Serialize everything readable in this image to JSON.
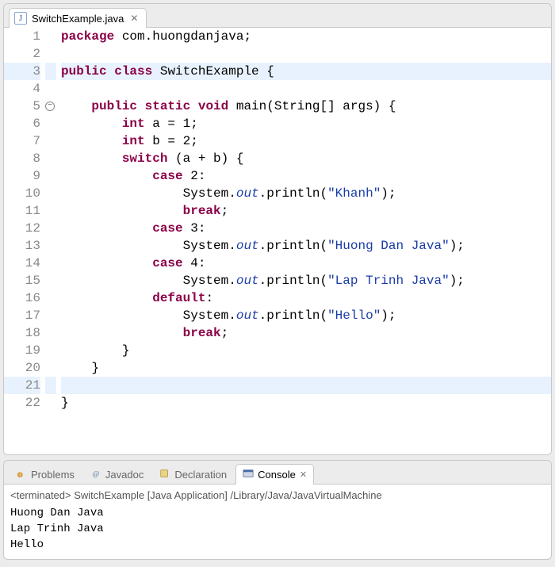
{
  "editor": {
    "tab": {
      "filename": "SwitchExample.java",
      "icon_letter": "J"
    },
    "fold_marker_line": 5,
    "highlighted_lines": [
      3,
      21
    ],
    "line_count": 22,
    "code_lines": [
      {
        "n": 1,
        "tokens": [
          [
            "kw",
            "package"
          ],
          [
            "",
            " com.huongdanjava;"
          ]
        ]
      },
      {
        "n": 2,
        "tokens": []
      },
      {
        "n": 3,
        "tokens": [
          [
            "kw",
            "public"
          ],
          [
            "",
            " "
          ],
          [
            "kw",
            "class"
          ],
          [
            "",
            " SwitchExample {"
          ]
        ]
      },
      {
        "n": 4,
        "tokens": []
      },
      {
        "n": 5,
        "tokens": [
          [
            "",
            "    "
          ],
          [
            "kw",
            "public"
          ],
          [
            "",
            " "
          ],
          [
            "kw",
            "static"
          ],
          [
            "",
            " "
          ],
          [
            "kw",
            "void"
          ],
          [
            "",
            " main(String[] args) {"
          ]
        ]
      },
      {
        "n": 6,
        "tokens": [
          [
            "",
            "        "
          ],
          [
            "kw",
            "int"
          ],
          [
            "",
            " a = 1;"
          ]
        ]
      },
      {
        "n": 7,
        "tokens": [
          [
            "",
            "        "
          ],
          [
            "kw",
            "int"
          ],
          [
            "",
            " b = 2;"
          ]
        ]
      },
      {
        "n": 8,
        "tokens": [
          [
            "",
            "        "
          ],
          [
            "kw",
            "switch"
          ],
          [
            "",
            " (a + b) {"
          ]
        ]
      },
      {
        "n": 9,
        "tokens": [
          [
            "",
            "            "
          ],
          [
            "kw",
            "case"
          ],
          [
            "",
            " 2:"
          ]
        ]
      },
      {
        "n": 10,
        "tokens": [
          [
            "",
            "                System."
          ],
          [
            "fld",
            "out"
          ],
          [
            "",
            ".println("
          ],
          [
            "str",
            "\"Khanh\""
          ],
          [
            "",
            ");"
          ]
        ]
      },
      {
        "n": 11,
        "tokens": [
          [
            "",
            "                "
          ],
          [
            "kw",
            "break"
          ],
          [
            "",
            ";"
          ]
        ]
      },
      {
        "n": 12,
        "tokens": [
          [
            "",
            "            "
          ],
          [
            "kw",
            "case"
          ],
          [
            "",
            " 3:"
          ]
        ]
      },
      {
        "n": 13,
        "tokens": [
          [
            "",
            "                System."
          ],
          [
            "fld",
            "out"
          ],
          [
            "",
            ".println("
          ],
          [
            "str",
            "\"Huong Dan Java\""
          ],
          [
            "",
            ");"
          ]
        ]
      },
      {
        "n": 14,
        "tokens": [
          [
            "",
            "            "
          ],
          [
            "kw",
            "case"
          ],
          [
            "",
            " 4:"
          ]
        ]
      },
      {
        "n": 15,
        "tokens": [
          [
            "",
            "                System."
          ],
          [
            "fld",
            "out"
          ],
          [
            "",
            ".println("
          ],
          [
            "str",
            "\"Lap Trinh Java\""
          ],
          [
            "",
            ");"
          ]
        ]
      },
      {
        "n": 16,
        "tokens": [
          [
            "",
            "            "
          ],
          [
            "kw",
            "default"
          ],
          [
            "",
            ":"
          ]
        ]
      },
      {
        "n": 17,
        "tokens": [
          [
            "",
            "                System."
          ],
          [
            "fld",
            "out"
          ],
          [
            "",
            ".println("
          ],
          [
            "str",
            "\"Hello\""
          ],
          [
            "",
            ");"
          ]
        ]
      },
      {
        "n": 18,
        "tokens": [
          [
            "",
            "                "
          ],
          [
            "kw",
            "break"
          ],
          [
            "",
            ";"
          ]
        ]
      },
      {
        "n": 19,
        "tokens": [
          [
            "",
            "        }"
          ]
        ]
      },
      {
        "n": 20,
        "tokens": [
          [
            "",
            "    }"
          ]
        ]
      },
      {
        "n": 21,
        "tokens": []
      },
      {
        "n": 22,
        "tokens": [
          [
            "",
            "}"
          ]
        ]
      }
    ]
  },
  "views": {
    "tabs": [
      {
        "id": "problems",
        "label": "Problems",
        "active": false,
        "icon": "problems-icon"
      },
      {
        "id": "javadoc",
        "label": "Javadoc",
        "active": false,
        "icon": "javadoc-icon"
      },
      {
        "id": "declaration",
        "label": "Declaration",
        "active": false,
        "icon": "declaration-icon"
      },
      {
        "id": "console",
        "label": "Console",
        "active": true,
        "icon": "console-icon"
      }
    ]
  },
  "console": {
    "status": "<terminated> SwitchExample [Java Application] /Library/Java/JavaVirtualMachine",
    "lines": [
      "Huong Dan Java",
      "Lap Trinh Java",
      "Hello"
    ]
  }
}
